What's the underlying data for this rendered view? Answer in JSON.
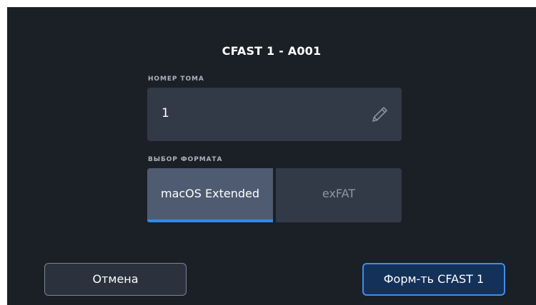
{
  "dialog": {
    "title": "CFAST 1 - A001"
  },
  "volume": {
    "label": "НОМЕР ТОМА",
    "value": "1",
    "edit_icon": "pencil-icon"
  },
  "format": {
    "label": "ВЫБОР ФОРМАТА",
    "options": [
      {
        "label": "macOS Extended",
        "selected": true
      },
      {
        "label": "exFAT",
        "selected": false
      }
    ]
  },
  "buttons": {
    "cancel_label": "Отмена",
    "format_label": "Форм-ть CFAST 1"
  },
  "colors": {
    "background": "#1b1f26",
    "field": "#323a47",
    "selected_option": "#4e5b70",
    "accent": "#2f8be6"
  }
}
